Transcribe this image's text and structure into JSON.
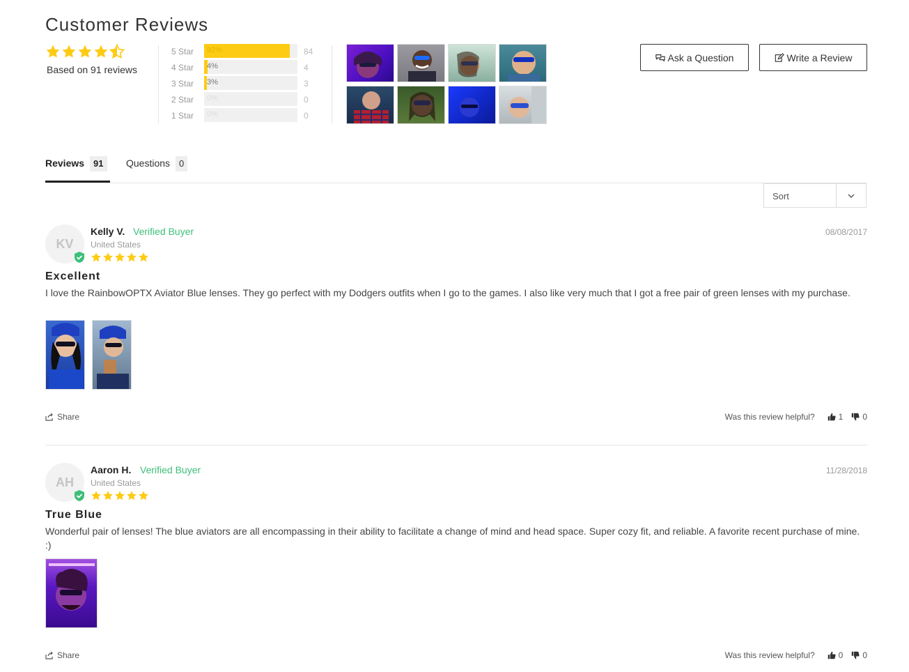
{
  "header": {
    "title": "Customer Reviews",
    "based_on": "Based on 91 reviews",
    "average_rating": 4.5
  },
  "histogram": [
    {
      "label": "5 Star",
      "pct": "92%",
      "fraction": 0.92,
      "count": "84"
    },
    {
      "label": "4 Star",
      "pct": "4%",
      "fraction": 0.04,
      "count": "4"
    },
    {
      "label": "3 Star",
      "pct": "3%",
      "fraction": 0.03,
      "count": "3"
    },
    {
      "label": "2 Star",
      "pct": "0%",
      "fraction": 0,
      "count": "0"
    },
    {
      "label": "1 Star",
      "pct": "0%",
      "fraction": 0,
      "count": "0"
    }
  ],
  "actions": {
    "ask_question": "Ask a Question",
    "write_review": "Write a Review"
  },
  "tabs": [
    {
      "label": "Reviews",
      "count": "91"
    },
    {
      "label": "Questions",
      "count": "0"
    }
  ],
  "sort": {
    "label": "Sort"
  },
  "reviews": [
    {
      "initials": "KV",
      "author": "Kelly V.",
      "verified": "Verified Buyer",
      "location": "United States",
      "rating": 5,
      "date": "08/08/2017",
      "title": "Excellent",
      "body": "I love the RainbowOPTX Aviator Blue lenses. They go perfect with my Dodgers outfits when I go to the games. I also like very much that I got a free pair of green lenses with my purchase.",
      "share": "Share",
      "helpful_prompt": "Was this review helpful?",
      "up": "1",
      "down": "0"
    },
    {
      "initials": "AH",
      "author": "Aaron H.",
      "verified": "Verified Buyer",
      "location": "United States",
      "rating": 5,
      "date": "11/28/2018",
      "title": "True Blue",
      "body": "Wonderful pair of lenses! The blue aviators are all encompassing in their ability to facilitate a change of mind and head space. Super cozy fit, and reliable. A favorite recent purchase of mine. :)",
      "share": "Share",
      "helpful_prompt": "Was this review helpful?",
      "up": "0",
      "down": "0"
    }
  ],
  "colors": {
    "star": "#fdcb14",
    "verified": "#3dbf7a",
    "bar_bg": "#f0f0f0"
  }
}
